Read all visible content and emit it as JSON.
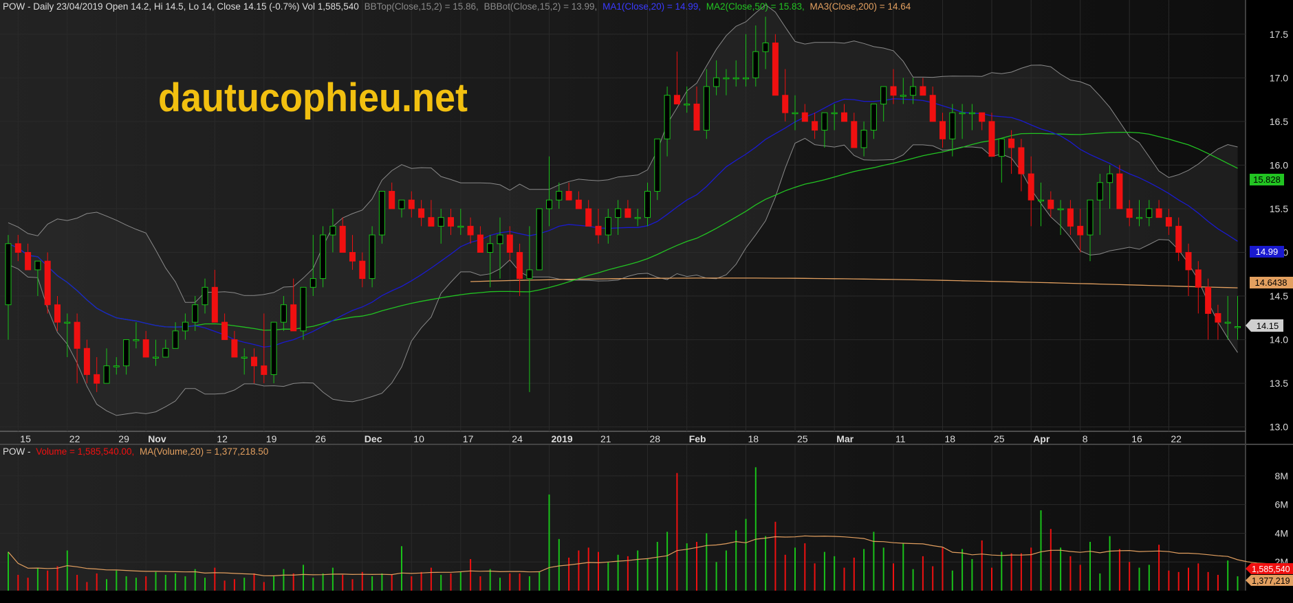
{
  "colors": {
    "background": "#000000",
    "pane_bg_light": "#1e1e1e",
    "pane_bg_dark": "#101010",
    "grid": "#2a2a2a",
    "up": "#19c219",
    "down": "#f01010",
    "bollinger": "#8a8a8a",
    "ma20": "#1a1ad0",
    "ma50": "#22c422",
    "ma200": "#e3a060",
    "volume_ma": "#e3a060",
    "watermark": "#f2c010",
    "axis_text": "#dddddd"
  },
  "header": {
    "symbol_line": "POW - Daily 23/04/2019 Open 14.2, Hi 14.5, Lo 14, Close 14.15 (-0.7%) Vol 1,585,540",
    "bbtop": "BBTop(Close,15,2) = 15.86,",
    "bbbot": "BBBot(Close,15,2) = 13.99,",
    "ma1": "MA1(Close,20) = 14.99,",
    "ma2": "MA2(Close,50) = 15.83,",
    "ma3": "MA3(Close,200) = 14.64"
  },
  "watermark": "dautucophieu.net",
  "volume_header": {
    "prefix": "POW -",
    "volume": "Volume = 1,585,540.00,",
    "ma": "MA(Volume,20) = 1,377,218.50"
  },
  "x_axis_labels": [
    {
      "i": 1,
      "label": "15",
      "bold": false
    },
    {
      "i": 6,
      "label": "22",
      "bold": false
    },
    {
      "i": 11,
      "label": "29",
      "bold": false
    },
    {
      "i": 14,
      "label": "Nov",
      "bold": true
    },
    {
      "i": 21,
      "label": "12",
      "bold": false
    },
    {
      "i": 26,
      "label": "19",
      "bold": false
    },
    {
      "i": 31,
      "label": "26",
      "bold": false
    },
    {
      "i": 36,
      "label": "Dec",
      "bold": true
    },
    {
      "i": 41,
      "label": "10",
      "bold": false
    },
    {
      "i": 46,
      "label": "17",
      "bold": false
    },
    {
      "i": 51,
      "label": "24",
      "bold": false
    },
    {
      "i": 55,
      "label": "2019",
      "bold": true
    },
    {
      "i": 60,
      "label": "21",
      "bold": false
    },
    {
      "i": 65,
      "label": "28",
      "bold": false
    },
    {
      "i": 69,
      "label": "Feb",
      "bold": true
    },
    {
      "i": 75,
      "label": "18",
      "bold": false
    },
    {
      "i": 80,
      "label": "25",
      "bold": false
    },
    {
      "i": 84,
      "label": "Mar",
      "bold": true
    },
    {
      "i": 90,
      "label": "11",
      "bold": false
    },
    {
      "i": 95,
      "label": "18",
      "bold": false
    },
    {
      "i": 100,
      "label": "25",
      "bold": false
    },
    {
      "i": 104,
      "label": "Apr",
      "bold": true
    },
    {
      "i": 109,
      "label": "8",
      "bold": false
    },
    {
      "i": 114,
      "label": "16",
      "bold": false
    },
    {
      "i": 118,
      "label": "22",
      "bold": false
    }
  ],
  "price_axis": {
    "ticks": [
      "13.0",
      "13.5",
      "14.0",
      "14.5",
      "15.0",
      "15.5",
      "16.0",
      "16.5",
      "17.0",
      "17.5"
    ],
    "tags": {
      "ma50": "15.828",
      "ma20": "14.99",
      "ma200": "14.6438",
      "close": "14.15"
    }
  },
  "volume_axis": {
    "ticks": [
      "2M",
      "4M",
      "6M",
      "8M"
    ],
    "tags": {
      "volume": "1,585,540",
      "ma": "1,377,219"
    }
  },
  "chart_data": {
    "type": "candlestick",
    "symbol": "POW",
    "period": "Daily",
    "ylim": [
      12.95,
      17.75
    ],
    "volume_ylim": [
      0,
      9000000
    ],
    "dates": [
      "2018-10-11",
      "2018-10-12",
      "2018-10-15",
      "2018-10-16",
      "2018-10-17",
      "2018-10-18",
      "2018-10-19",
      "2018-10-22",
      "2018-10-23",
      "2018-10-24",
      "2018-10-25",
      "2018-10-26",
      "2018-10-29",
      "2018-10-30",
      "2018-10-31",
      "2018-11-01",
      "2018-11-02",
      "2018-11-05",
      "2018-11-06",
      "2018-11-07",
      "2018-11-08",
      "2018-11-09",
      "2018-11-12",
      "2018-11-13",
      "2018-11-14",
      "2018-11-15",
      "2018-11-16",
      "2018-11-19",
      "2018-11-20",
      "2018-11-21",
      "2018-11-22",
      "2018-11-23",
      "2018-11-26",
      "2018-11-27",
      "2018-11-28",
      "2018-11-29",
      "2018-11-30",
      "2018-12-03",
      "2018-12-04",
      "2018-12-05",
      "2018-12-06",
      "2018-12-07",
      "2018-12-10",
      "2018-12-11",
      "2018-12-12",
      "2018-12-13",
      "2018-12-14",
      "2018-12-17",
      "2018-12-18",
      "2018-12-19",
      "2018-12-20",
      "2018-12-21",
      "2018-12-24",
      "2018-12-25",
      "2018-12-26",
      "2018-12-27",
      "2018-12-28",
      "2019-01-02",
      "2019-01-03",
      "2019-01-04",
      "2019-01-07",
      "2019-01-08",
      "2019-01-09",
      "2019-01-10",
      "2019-01-11",
      "2019-01-14",
      "2019-01-15",
      "2019-01-16",
      "2019-01-17",
      "2019-01-18",
      "2019-01-21",
      "2019-01-22",
      "2019-01-23",
      "2019-01-24",
      "2019-01-25",
      "2019-01-28",
      "2019-01-29",
      "2019-01-30",
      "2019-01-31",
      "2019-02-01",
      "2019-02-11",
      "2019-02-12",
      "2019-02-13",
      "2019-02-14",
      "2019-02-15",
      "2019-02-18",
      "2019-02-19",
      "2019-02-20",
      "2019-02-21",
      "2019-02-22",
      "2019-02-25",
      "2019-02-26",
      "2019-02-27",
      "2019-02-28",
      "2019-03-01",
      "2019-03-04",
      "2019-03-05",
      "2019-03-06",
      "2019-03-07",
      "2019-03-08",
      "2019-03-11",
      "2019-03-12",
      "2019-03-13",
      "2019-03-14",
      "2019-03-15",
      "2019-03-18",
      "2019-03-19",
      "2019-03-20",
      "2019-03-21",
      "2019-03-22",
      "2019-03-25",
      "2019-03-26",
      "2019-03-27",
      "2019-03-28",
      "2019-03-29",
      "2019-04-01",
      "2019-04-02",
      "2019-04-03",
      "2019-04-04",
      "2019-04-05",
      "2019-04-08",
      "2019-04-09",
      "2019-04-10",
      "2019-04-11",
      "2019-04-12",
      "2019-04-16",
      "2019-04-17",
      "2019-04-18",
      "2019-04-19",
      "2019-04-22",
      "2019-04-23"
    ],
    "open": [
      14.4,
      15.1,
      15.0,
      14.8,
      14.9,
      14.4,
      14.2,
      14.2,
      13.9,
      13.6,
      13.5,
      13.7,
      13.7,
      14.0,
      14.0,
      13.8,
      13.8,
      13.9,
      14.1,
      14.2,
      14.4,
      14.6,
      14.2,
      14.0,
      13.8,
      13.8,
      13.7,
      13.6,
      14.2,
      14.4,
      14.1,
      14.6,
      14.7,
      15.2,
      15.3,
      15.0,
      14.9,
      14.7,
      15.2,
      15.7,
      15.5,
      15.6,
      15.5,
      15.4,
      15.3,
      15.4,
      15.3,
      15.3,
      15.2,
      15.0,
      15.1,
      15.2,
      15.0,
      14.7,
      14.8,
      15.5,
      15.6,
      15.7,
      15.6,
      15.5,
      15.3,
      15.2,
      15.4,
      15.5,
      15.4,
      15.4,
      15.7,
      16.3,
      16.8,
      16.7,
      16.7,
      16.4,
      16.9,
      17.0,
      17.0,
      17.0,
      17.0,
      17.3,
      17.4,
      16.8,
      16.6,
      16.6,
      16.5,
      16.4,
      16.6,
      16.6,
      16.5,
      16.2,
      16.4,
      16.7,
      16.9,
      16.8,
      16.8,
      16.9,
      16.8,
      16.5,
      16.3,
      16.6,
      16.6,
      16.6,
      16.5,
      16.1,
      16.3,
      16.2,
      15.9,
      15.6,
      15.6,
      15.5,
      15.5,
      15.3,
      15.2,
      15.6,
      15.8,
      15.9,
      15.5,
      15.4,
      15.4,
      15.5,
      15.4,
      15.3,
      15.0,
      14.8,
      14.6,
      14.3,
      14.2,
      14.15
    ],
    "high": [
      15.2,
      15.2,
      15.1,
      14.9,
      15.0,
      14.5,
      14.3,
      14.3,
      14.0,
      13.8,
      13.9,
      13.8,
      13.9,
      14.2,
      14.1,
      14.0,
      14.0,
      14.2,
      14.3,
      14.5,
      14.7,
      14.8,
      14.3,
      14.1,
      13.9,
      13.9,
      14.3,
      14.0,
      14.5,
      14.7,
      14.4,
      15.2,
      15.3,
      15.5,
      15.4,
      15.2,
      15.0,
      15.3,
      15.7,
      15.8,
      15.6,
      15.7,
      15.6,
      15.6,
      15.5,
      15.5,
      15.5,
      15.4,
      15.3,
      15.2,
      15.4,
      15.3,
      15.1,
      15.3,
      15.5,
      16.1,
      15.8,
      15.8,
      15.7,
      15.6,
      15.5,
      15.5,
      15.6,
      15.6,
      15.5,
      15.8,
      16.3,
      16.9,
      17.3,
      16.9,
      16.9,
      17.1,
      17.2,
      17.1,
      17.2,
      17.5,
      17.6,
      17.7,
      17.5,
      17.1,
      16.8,
      16.7,
      16.6,
      16.6,
      16.7,
      16.7,
      16.6,
      16.5,
      16.7,
      16.9,
      17.1,
      17.0,
      17.0,
      17.0,
      16.9,
      16.6,
      16.7,
      16.7,
      16.7,
      16.6,
      16.6,
      16.3,
      16.4,
      16.3,
      16.1,
      15.8,
      15.7,
      15.6,
      15.6,
      15.5,
      15.5,
      15.9,
      16.0,
      16.0,
      15.6,
      15.6,
      15.6,
      15.6,
      15.5,
      15.4,
      15.1,
      14.9,
      14.7,
      14.4,
      14.5,
      14.5
    ],
    "low": [
      14.0,
      14.9,
      14.8,
      14.5,
      14.3,
      14.1,
      13.8,
      13.5,
      13.5,
      13.4,
      13.5,
      13.6,
      13.6,
      13.9,
      13.9,
      13.7,
      13.8,
      13.9,
      14.0,
      14.1,
      14.3,
      14.4,
      14.0,
      13.8,
      13.6,
      13.5,
      13.5,
      13.5,
      14.1,
      14.1,
      14.0,
      14.5,
      14.6,
      15.0,
      15.0,
      14.8,
      14.6,
      14.6,
      15.1,
      15.5,
      15.4,
      15.4,
      15.3,
      15.3,
      15.1,
      15.2,
      15.2,
      15.1,
      15.0,
      14.6,
      14.7,
      14.9,
      14.5,
      13.4,
      14.8,
      15.3,
      15.5,
      15.6,
      15.5,
      15.3,
      15.1,
      15.1,
      15.2,
      15.4,
      15.3,
      15.3,
      15.6,
      16.1,
      16.7,
      16.6,
      16.6,
      16.3,
      16.8,
      16.8,
      16.9,
      16.9,
      16.9,
      17.1,
      16.8,
      16.5,
      16.4,
      16.5,
      16.3,
      16.2,
      16.4,
      16.5,
      16.2,
      16.1,
      16.3,
      16.5,
      16.7,
      16.7,
      16.7,
      16.8,
      16.5,
      16.2,
      16.1,
      16.3,
      16.4,
      16.4,
      16.2,
      15.8,
      15.9,
      15.7,
      15.3,
      15.3,
      15.4,
      15.2,
      15.2,
      15.0,
      14.9,
      15.2,
      15.5,
      15.5,
      15.3,
      15.3,
      15.3,
      15.4,
      15.2,
      14.9,
      14.5,
      14.3,
      14.0,
      14.0,
      14.0,
      14.0
    ],
    "close": [
      15.1,
      15.0,
      14.8,
      14.9,
      14.4,
      14.2,
      14.2,
      13.9,
      13.6,
      13.5,
      13.7,
      13.7,
      14.0,
      14.0,
      13.8,
      13.8,
      13.9,
      14.1,
      14.2,
      14.4,
      14.6,
      14.2,
      14.0,
      13.8,
      13.8,
      13.7,
      13.6,
      14.2,
      14.4,
      14.1,
      14.6,
      14.7,
      15.2,
      15.3,
      15.0,
      14.9,
      14.7,
      15.2,
      15.7,
      15.5,
      15.6,
      15.5,
      15.4,
      15.3,
      15.4,
      15.3,
      15.3,
      15.2,
      15.0,
      15.1,
      15.2,
      15.0,
      14.7,
      14.8,
      15.5,
      15.6,
      15.7,
      15.6,
      15.5,
      15.3,
      15.2,
      15.4,
      15.5,
      15.4,
      15.4,
      15.7,
      16.3,
      16.8,
      16.7,
      16.7,
      16.4,
      16.9,
      17.0,
      17.0,
      17.0,
      17.0,
      17.3,
      17.4,
      16.8,
      16.6,
      16.6,
      16.5,
      16.4,
      16.6,
      16.6,
      16.5,
      16.2,
      16.4,
      16.7,
      16.9,
      16.8,
      16.8,
      16.9,
      16.8,
      16.5,
      16.3,
      16.6,
      16.6,
      16.6,
      16.5,
      16.1,
      16.3,
      16.2,
      15.9,
      15.6,
      15.6,
      15.5,
      15.5,
      15.3,
      15.2,
      15.6,
      15.8,
      15.9,
      15.5,
      15.4,
      15.4,
      15.5,
      15.4,
      15.3,
      15.0,
      14.8,
      14.6,
      14.3,
      14.2,
      14.2,
      14.15
    ],
    "volume": [
      2.7,
      1.1,
      0.9,
      1.6,
      1.4,
      1.7,
      2.8,
      1.1,
      0.6,
      1.2,
      0.8,
      1.4,
      1.0,
      0.9,
      1.0,
      1.3,
      1.1,
      1.2,
      1.0,
      1.5,
      0.9,
      1.6,
      0.7,
      0.8,
      0.9,
      1.2,
      0.6,
      1.0,
      1.5,
      1.2,
      1.8,
      0.9,
      1.2,
      1.6,
      1.1,
      0.8,
      1.3,
      1.0,
      1.2,
      1.1,
      3.1,
      1.0,
      1.3,
      1.6,
      1.1,
      1.2,
      1.3,
      2.2,
      1.0,
      1.5,
      0.9,
      1.2,
      1.2,
      1.0,
      1.3,
      6.7,
      3.6,
      2.3,
      2.8,
      3.0,
      2.7,
      2.0,
      2.5,
      2.4,
      2.8,
      2.2,
      3.4,
      4.1,
      8.2,
      3.3,
      3.4,
      4.0,
      2.0,
      2.8,
      4.2,
      5.0,
      8.6,
      3.8,
      4.8,
      2.5,
      3.0,
      3.3,
      1.9,
      2.7,
      2.4,
      1.6,
      2.3,
      2.9,
      4.1,
      3.0,
      1.9,
      3.3,
      1.5,
      2.4,
      1.7,
      3.0,
      1.4,
      2.9,
      2.2,
      3.5,
      1.6,
      2.7,
      2.6,
      2.6,
      3.0,
      5.6,
      4.3,
      3.0,
      2.4,
      1.8,
      3.4,
      1.2,
      3.8,
      2.9,
      2.0,
      1.6,
      1.8,
      3.2,
      1.4,
      1.3,
      1.6,
      1.9,
      1.3,
      1.1,
      2.1,
      1.0,
      1.4,
      1.3,
      1.6
    ]
  }
}
